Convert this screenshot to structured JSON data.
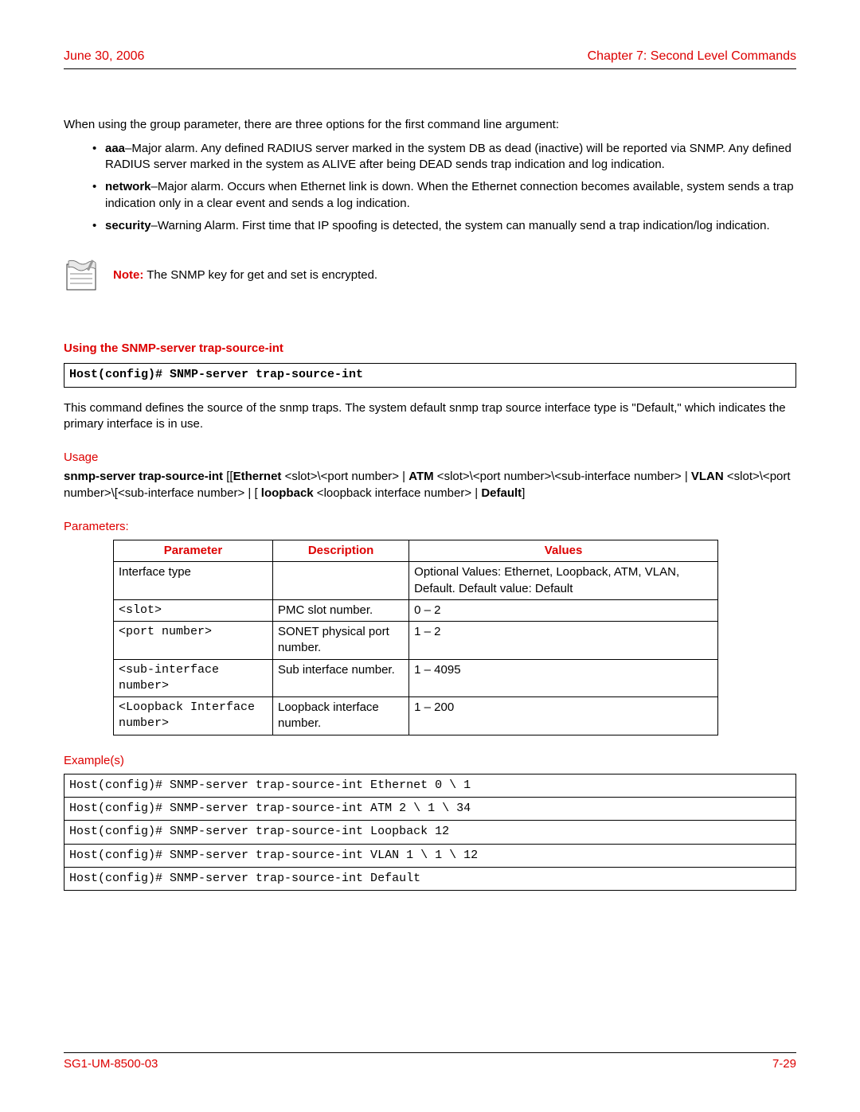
{
  "header": {
    "left": "June 30, 2006",
    "right": "Chapter 7: Second Level Commands"
  },
  "intro": "When using the group parameter, there are three options for the first command line argument:",
  "bullets": [
    {
      "label": "aaa",
      "text": "–Major alarm. Any defined RADIUS server marked in the system DB as dead (inactive) will be reported via SNMP. Any defined RADIUS server marked in the system as ALIVE after being DEAD sends trap indication and log indication."
    },
    {
      "label": "network",
      "text": "–Major alarm. Occurs when Ethernet link is down. When the Ethernet connection becomes available, system sends a trap indication only in a clear event and sends a log indication."
    },
    {
      "label": "security",
      "text": "–Warning Alarm. First time that IP spoofing is detected, the system can manually send a trap indication/log indication."
    }
  ],
  "note": {
    "label": "Note:",
    "text": " The SNMP key for get and set is encrypted."
  },
  "section_title": "Using the SNMP-server trap-source-int",
  "code_command": "Host(config)# SNMP-server trap-source-int",
  "command_desc": "This command defines the source of the snmp traps. The system default snmp trap source interface type is \"Default,\" which indicates the primary interface is in use.",
  "usage_label": "Usage",
  "usage": {
    "prefix": "snmp-server trap-source-int",
    "eth": "Ethernet",
    "eth_args": " <slot>\\<port number> | ",
    "atm": "ATM",
    "atm_args": " <slot>\\<port number>\\<sub-interface number> | ",
    "vlan": "VLAN",
    "vlan_args": " <slot>\\<port number>\\[<sub-interface number> | [ ",
    "loop": "loopback",
    "loop_args": " <loopback interface number> | ",
    "def": "Default",
    "suffix": "]"
  },
  "params_label": "Parameters:",
  "table": {
    "headers": {
      "c1": "Parameter",
      "c2": "Description",
      "c3": "Values"
    },
    "rows": [
      {
        "p": "Interface type",
        "d": "",
        "v": "Optional Values: Ethernet, Loopback, ATM, VLAN, Default. Default value: Default",
        "mono": false
      },
      {
        "p": "<slot>",
        "d": "PMC slot number.",
        "v": "0 – 2",
        "mono": true
      },
      {
        "p": "<port number>",
        "d": "SONET physical port number.",
        "v": "1 – 2",
        "mono": true
      },
      {
        "p": "<sub-interface number>",
        "d": "Sub interface number.",
        "v": "1 – 4095",
        "mono": true
      },
      {
        "p": "<Loopback Interface number>",
        "d": "Loopback interface number.",
        "v": "1 – 200",
        "mono": true
      }
    ]
  },
  "examples_label": "Example(s)",
  "examples": [
    "Host(config)# SNMP-server trap-source-int Ethernet 0 \\ 1",
    "Host(config)# SNMP-server trap-source-int ATM 2 \\ 1 \\ 34",
    "Host(config)# SNMP-server trap-source-int Loopback 12",
    "Host(config)# SNMP-server trap-source-int VLAN 1 \\ 1 \\ 12",
    "Host(config)# SNMP-server trap-source-int Default"
  ],
  "footer": {
    "left": "SG1-UM-8500-03",
    "right": "7-29"
  }
}
